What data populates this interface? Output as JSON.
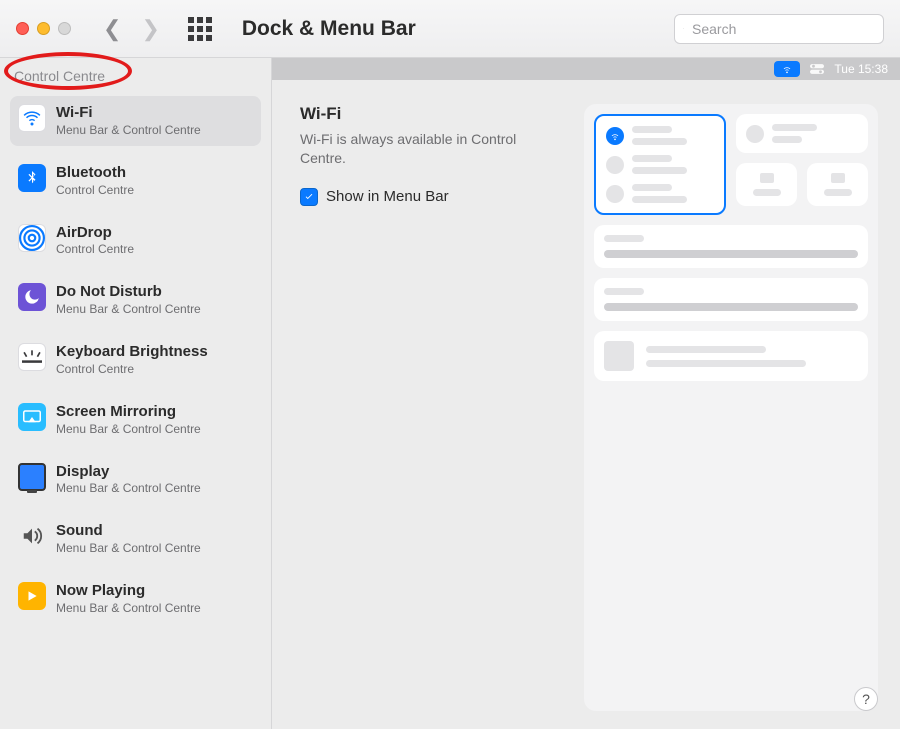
{
  "toolbar": {
    "title": "Dock & Menu Bar",
    "search_placeholder": "Search"
  },
  "sidebar": {
    "section_title": "Control Centre",
    "items": [
      {
        "title": "Wi-Fi",
        "subtitle": "Menu Bar & Control Centre",
        "icon": "wifi"
      },
      {
        "title": "Bluetooth",
        "subtitle": "Control Centre",
        "icon": "bluetooth"
      },
      {
        "title": "AirDrop",
        "subtitle": "Control Centre",
        "icon": "airdrop"
      },
      {
        "title": "Do Not Disturb",
        "subtitle": "Menu Bar & Control Centre",
        "icon": "dnd"
      },
      {
        "title": "Keyboard Brightness",
        "subtitle": "Control Centre",
        "icon": "kb"
      },
      {
        "title": "Screen Mirroring",
        "subtitle": "Menu Bar & Control Centre",
        "icon": "mirror"
      },
      {
        "title": "Display",
        "subtitle": "Menu Bar & Control Centre",
        "icon": "display"
      },
      {
        "title": "Sound",
        "subtitle": "Menu Bar & Control Centre",
        "icon": "sound"
      },
      {
        "title": "Now Playing",
        "subtitle": "Menu Bar & Control Centre",
        "icon": "nowplaying"
      }
    ]
  },
  "menubar": {
    "clock": "Tue 15:38"
  },
  "detail": {
    "heading": "Wi-Fi",
    "description": "Wi-Fi is always available in Control Centre.",
    "checkbox_label": "Show in Menu Bar",
    "checkbox_checked": true
  },
  "help": {
    "label": "?"
  }
}
